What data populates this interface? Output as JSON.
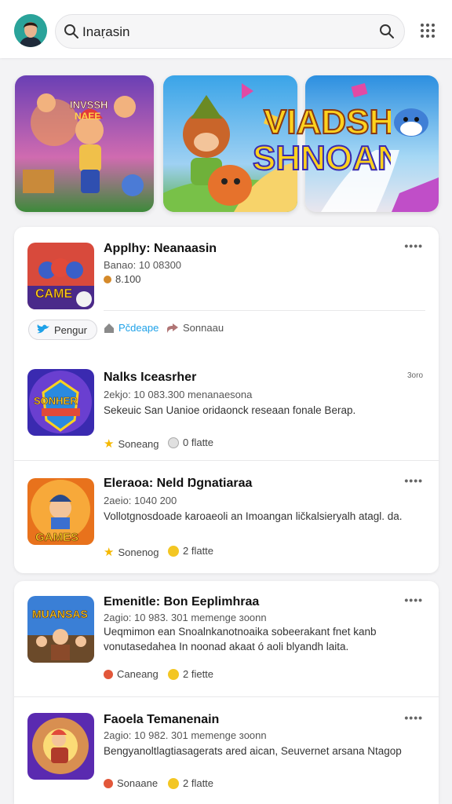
{
  "header": {
    "search_text": "Inaṛasin",
    "search_icon": "search-icon",
    "menu_icon": "grid-menu-icon"
  },
  "banners": [
    {
      "title_line1": "INVSSH",
      "title_line2": "NAEE"
    },
    {
      "title_line1": "",
      "title_line2": ""
    },
    {
      "title_line1": "VIADSH",
      "title_line2": "SHNOAN"
    }
  ],
  "featured": {
    "title": "Applhy: Neanaasin",
    "meta": "Banao: 10 08300",
    "rating": "8.100",
    "thumb_text": "CAME",
    "share_label": "Pengur",
    "action1_label": "Pčdeape",
    "action2_label": "Sonnaau",
    "more": "••••"
  },
  "list": [
    {
      "title": "Nalks Iceasrher",
      "meta": "2ekjo: 10 083.300  menanaesona",
      "desc": "Sekeuic San Uanioe oridaonck reseaan fonale Berap.",
      "thumb_text": "SONHER",
      "stat1": "Soneang",
      "stat2": "0 flatte",
      "more": "3oro"
    },
    {
      "title": "Eleraoa: Neld Ŋgnatiaraa",
      "meta": "2aeio: 1040 200",
      "desc": "Vollotgnosdoade karoaeoli an Imoangan ličkalsieryalh atagl. da.",
      "thumb_text": "GAMES",
      "stat1": "Sonenog",
      "stat2": "2 flatte",
      "more": "••••"
    },
    {
      "title": "Emenitle: Bon Eeplimhraa",
      "meta": "2agio: 10 983. 301  memenge ɜoonn",
      "desc": "Ueqmimon ean Snoalnkanotnoaika sobeerakant fnet kanb vonutasedahea In noonad akaat ó aoli blyandh laita.",
      "thumb_text": "MUANSAS",
      "stat1": "Caneang",
      "stat2": "2 fiette",
      "more": "••••"
    },
    {
      "title": "Faoela Temanenain",
      "meta": "2agio: 10 982. 301  memenge ɜoonn",
      "desc": "Bengyanoltlagtiasagerats ared aican, Seuvernet arsana Ntagop",
      "thumb_text": "",
      "stat1": "Sonaane",
      "stat2": "2 flatte",
      "more": "••••"
    }
  ],
  "colors": {
    "accent_blue": "#1ea1e8",
    "star": "#f5b800",
    "badge_yellow": "#f3c623",
    "card_bg": "#ffffff",
    "page_bg": "#f3f3f5"
  }
}
